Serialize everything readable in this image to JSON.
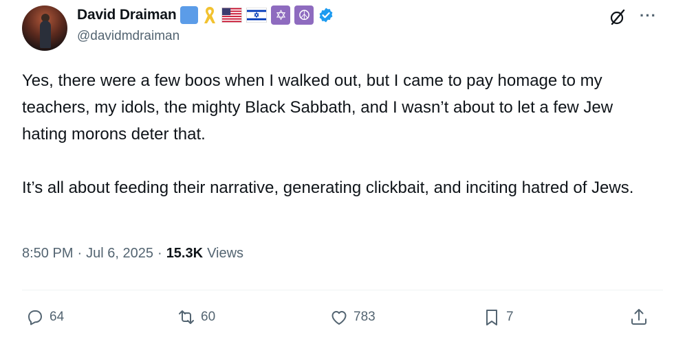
{
  "author": {
    "display_name": "David Draiman",
    "handle": "@davidmdraiman",
    "badges": [
      "blue-square-emoji",
      "yellow-ribbon-emoji",
      "us-flag-emoji",
      "israel-flag-emoji",
      "star-of-david-emoji",
      "peace-symbol-emoji",
      "verified-badge"
    ]
  },
  "tweet": {
    "paragraphs": [
      "Yes, there were a few boos when I walked out, but I came to pay homage to my teachers, my idols, the mighty Black Sabbath, and I wasn’t about to let a few Jew hating morons deter that.",
      "It’s all about feeding their narrative, generating clickbait, and inciting hatred of Jews."
    ],
    "time": "8:50 PM",
    "date": "Jul 6, 2025",
    "views_count": "15.3K",
    "views_label": "Views"
  },
  "actions": {
    "replies": "64",
    "reposts": "60",
    "likes": "783",
    "bookmarks": "7"
  },
  "symbols": {
    "star_of_david": "✡",
    "peace": "☮",
    "more": "···",
    "separator": "·"
  },
  "colors": {
    "text": "#0f1419",
    "secondary": "#536471",
    "verified": "#1d9bf0",
    "divider": "#eff3f4"
  }
}
